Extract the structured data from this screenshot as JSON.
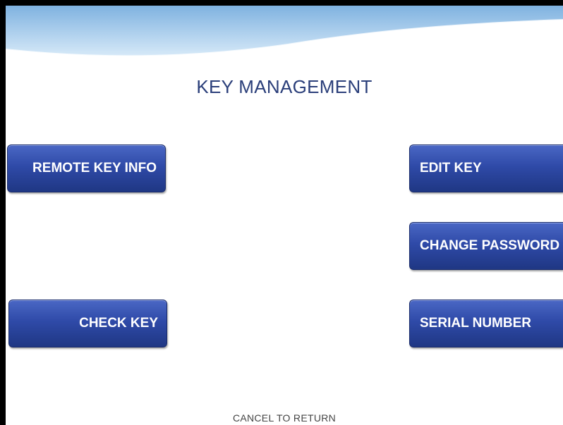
{
  "screen": {
    "title": "KEY MANAGEMENT",
    "footer": "CANCEL TO RETURN"
  },
  "buttons": {
    "remote_key_info": "REMOTE KEY INFO",
    "check_key": "CHECK KEY",
    "edit_key": "EDIT KEY",
    "change_password": "CHANGE PASSWORD",
    "serial_number": "SERIAL NUMBER"
  },
  "colors": {
    "title": "#2b3f7a",
    "button": "#2f4aa8",
    "header_wave": "#aacdef"
  }
}
